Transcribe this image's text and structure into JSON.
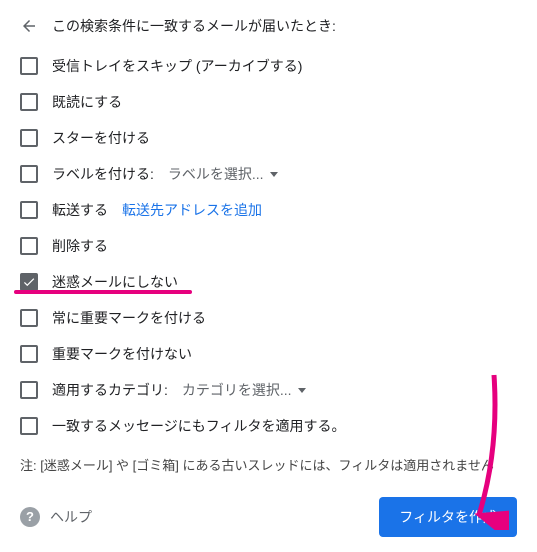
{
  "header": {
    "title": "この検索条件に一致するメールが届いたとき:"
  },
  "options": [
    {
      "key": "skip-inbox",
      "label": "受信トレイをスキップ (アーカイブする)",
      "checked": false
    },
    {
      "key": "mark-read",
      "label": "既読にする",
      "checked": false
    },
    {
      "key": "star",
      "label": "スターを付ける",
      "checked": false
    },
    {
      "key": "apply-label",
      "label": "ラベルを付ける:",
      "select": "ラベルを選択...",
      "checked": false
    },
    {
      "key": "forward",
      "label": "転送する",
      "link": "転送先アドレスを追加",
      "checked": false
    },
    {
      "key": "delete",
      "label": "削除する",
      "checked": false
    },
    {
      "key": "never-spam",
      "label": "迷惑メールにしない",
      "checked": true
    },
    {
      "key": "always-important",
      "label": "常に重要マークを付ける",
      "checked": false
    },
    {
      "key": "never-important",
      "label": "重要マークを付けない",
      "checked": false
    },
    {
      "key": "category",
      "label": "適用するカテゴリ:",
      "select": "カテゴリを選択...",
      "checked": false
    },
    {
      "key": "apply-matching",
      "label": "一致するメッセージにもフィルタを適用する。",
      "checked": false
    }
  ],
  "note": "注: [迷惑メール] や [ゴミ箱] にある古いスレッドには、フィルタは適用されません",
  "footer": {
    "help": "ヘルプ",
    "create_button": "フィルタを作成"
  },
  "annotation": {
    "arrow_color": "#e6007e"
  }
}
